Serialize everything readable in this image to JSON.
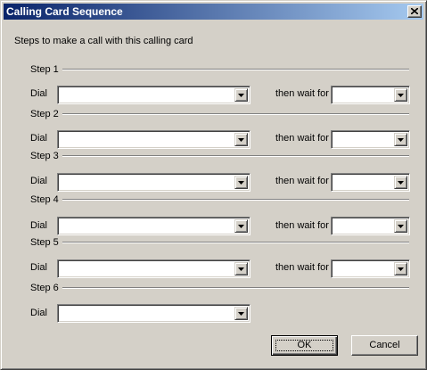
{
  "window": {
    "title": "Calling Card Sequence"
  },
  "description": "Steps to make a call with this calling card",
  "steps": [
    {
      "label": "Step 1",
      "dial_label": "Dial",
      "dial_value": "",
      "wait_label": "then wait for",
      "wait_value": ""
    },
    {
      "label": "Step 2",
      "dial_label": "Dial",
      "dial_value": "",
      "wait_label": "then wait for",
      "wait_value": ""
    },
    {
      "label": "Step 3",
      "dial_label": "Dial",
      "dial_value": "",
      "wait_label": "then wait for",
      "wait_value": ""
    },
    {
      "label": "Step 4",
      "dial_label": "Dial",
      "dial_value": "",
      "wait_label": "then wait for",
      "wait_value": ""
    },
    {
      "label": "Step 5",
      "dial_label": "Dial",
      "dial_value": "",
      "wait_label": "then wait for",
      "wait_value": ""
    },
    {
      "label": "Step 6",
      "dial_label": "Dial",
      "dial_value": ""
    }
  ],
  "buttons": {
    "ok": "OK",
    "cancel": "Cancel"
  },
  "icons": {
    "close": "close-icon",
    "dropdown": "chevron-down-icon"
  },
  "colors": {
    "titlebar_start": "#0a246a",
    "titlebar_end": "#a6caf0",
    "face": "#d4d0c8"
  }
}
